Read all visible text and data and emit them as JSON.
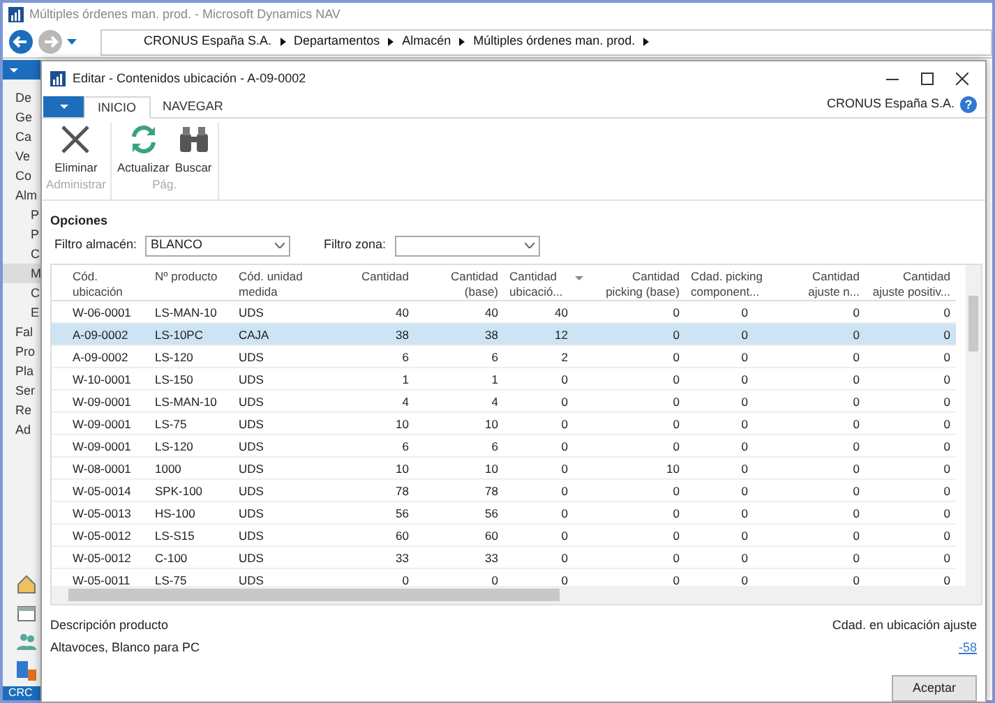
{
  "app": {
    "title": "Múltiples órdenes man. prod. - Microsoft Dynamics NAV",
    "breadcrumb": [
      "CRONUS España S.A.",
      "Departamentos",
      "Almacén",
      "Múltiples órdenes man. prod."
    ],
    "sidebar": [
      {
        "label": "De",
        "selected": false
      },
      {
        "label": "Ge",
        "selected": false
      },
      {
        "label": "Ca",
        "selected": false
      },
      {
        "label": "Ve",
        "selected": false
      },
      {
        "label": "Co",
        "selected": false
      },
      {
        "label": "Alm",
        "selected": false,
        "children": [
          {
            "label": "P",
            "selected": false
          },
          {
            "label": "P",
            "selected": false
          },
          {
            "label": "C",
            "selected": false
          },
          {
            "label": "M",
            "selected": true
          },
          {
            "label": "C",
            "selected": false
          },
          {
            "label": "E",
            "selected": false
          }
        ]
      },
      {
        "label": "Fal",
        "selected": false
      },
      {
        "label": "Pro",
        "selected": false
      },
      {
        "label": "Pla",
        "selected": false
      },
      {
        "label": "Ser",
        "selected": false
      },
      {
        "label": "Re",
        "selected": false
      },
      {
        "label": "Ad",
        "selected": false
      }
    ],
    "status_bar": "CRC"
  },
  "dialog": {
    "title": "Editar - Contenidos ubicación - A-09-0002",
    "tabs": [
      {
        "label": "INICIO",
        "selected": true
      },
      {
        "label": "NAVEGAR",
        "selected": false
      }
    ],
    "company": "CRONUS España S.A.",
    "help": "?",
    "ribbon_groups": [
      {
        "label": "Administrar",
        "actions": [
          {
            "label": "Eliminar",
            "kind": "delete"
          }
        ]
      },
      {
        "label": "Pág.",
        "actions": [
          {
            "label": "Actualizar",
            "kind": "refresh"
          },
          {
            "label": "Buscar",
            "kind": "find"
          }
        ]
      }
    ],
    "options_title": "Opciones",
    "filters": [
      {
        "label": "Filtro almacén:",
        "value": "BLANCO"
      },
      {
        "label": "Filtro zona:"
      }
    ],
    "table": {
      "columns": [
        {
          "label": "Cód.\nubicación",
          "sorted": false
        },
        {
          "label": "Nº producto",
          "sorted": false
        },
        {
          "label": "Cód. unidad\nmedida",
          "sorted": false
        },
        {
          "label": "Cantidad",
          "sorted": false
        },
        {
          "label": "Cantidad\n(base)",
          "sorted": false
        },
        {
          "label": "Cantidad\nubicació...",
          "sorted": true
        },
        {
          "label": "Cantidad\npicking (base)",
          "sorted": false
        },
        {
          "label": "Cdad. picking\ncomponent...",
          "sorted": false
        },
        {
          "label": "Cantidad\najuste n...",
          "sorted": false
        },
        {
          "label": "Cantidad\najuste positiv...",
          "sorted": false
        }
      ],
      "rows": [
        {
          "selected": false,
          "cells": [
            "W-06-0001",
            "LS-MAN-10",
            "UDS",
            "40",
            "40",
            "40",
            "0",
            "0",
            "0",
            "0"
          ]
        },
        {
          "selected": true,
          "cells": [
            "A-09-0002",
            "LS-10PC",
            "CAJA",
            "38",
            "38",
            "12",
            "0",
            "0",
            "0",
            "0"
          ]
        },
        {
          "selected": false,
          "cells": [
            "A-09-0002",
            "LS-120",
            "UDS",
            "6",
            "6",
            "2",
            "0",
            "0",
            "0",
            "0"
          ]
        },
        {
          "selected": false,
          "cells": [
            "W-10-0001",
            "LS-150",
            "UDS",
            "1",
            "1",
            "0",
            "0",
            "0",
            "0",
            "0"
          ]
        },
        {
          "selected": false,
          "cells": [
            "W-09-0001",
            "LS-MAN-10",
            "UDS",
            "4",
            "4",
            "0",
            "0",
            "0",
            "0",
            "0"
          ]
        },
        {
          "selected": false,
          "cells": [
            "W-09-0001",
            "LS-75",
            "UDS",
            "10",
            "10",
            "0",
            "0",
            "0",
            "0",
            "0"
          ]
        },
        {
          "selected": false,
          "cells": [
            "W-09-0001",
            "LS-120",
            "UDS",
            "6",
            "6",
            "0",
            "0",
            "0",
            "0",
            "0"
          ]
        },
        {
          "selected": false,
          "cells": [
            "W-08-0001",
            "1000",
            "UDS",
            "10",
            "10",
            "0",
            "10",
            "0",
            "0",
            "0"
          ]
        },
        {
          "selected": false,
          "cells": [
            "W-05-0014",
            "SPK-100",
            "UDS",
            "78",
            "78",
            "0",
            "0",
            "0",
            "0",
            "0"
          ]
        },
        {
          "selected": false,
          "cells": [
            "W-05-0013",
            "HS-100",
            "UDS",
            "56",
            "56",
            "0",
            "0",
            "0",
            "0",
            "0"
          ]
        },
        {
          "selected": false,
          "cells": [
            "W-05-0012",
            "LS-S15",
            "UDS",
            "60",
            "60",
            "0",
            "0",
            "0",
            "0",
            "0"
          ]
        },
        {
          "selected": false,
          "cells": [
            "W-05-0012",
            "C-100",
            "UDS",
            "33",
            "33",
            "0",
            "0",
            "0",
            "0",
            "0"
          ]
        },
        {
          "selected": false,
          "cells": [
            "W-05-0011",
            "LS-75",
            "UDS",
            "0",
            "0",
            "0",
            "0",
            "0",
            "0",
            "0"
          ]
        }
      ]
    },
    "footer": {
      "left_label": "Descripción producto",
      "left_value": "Altavoces, Blanco para PC",
      "right_label": "Cdad. en ubicación ajuste",
      "right_value": "-58"
    },
    "buttons": [
      "Aceptar"
    ]
  }
}
